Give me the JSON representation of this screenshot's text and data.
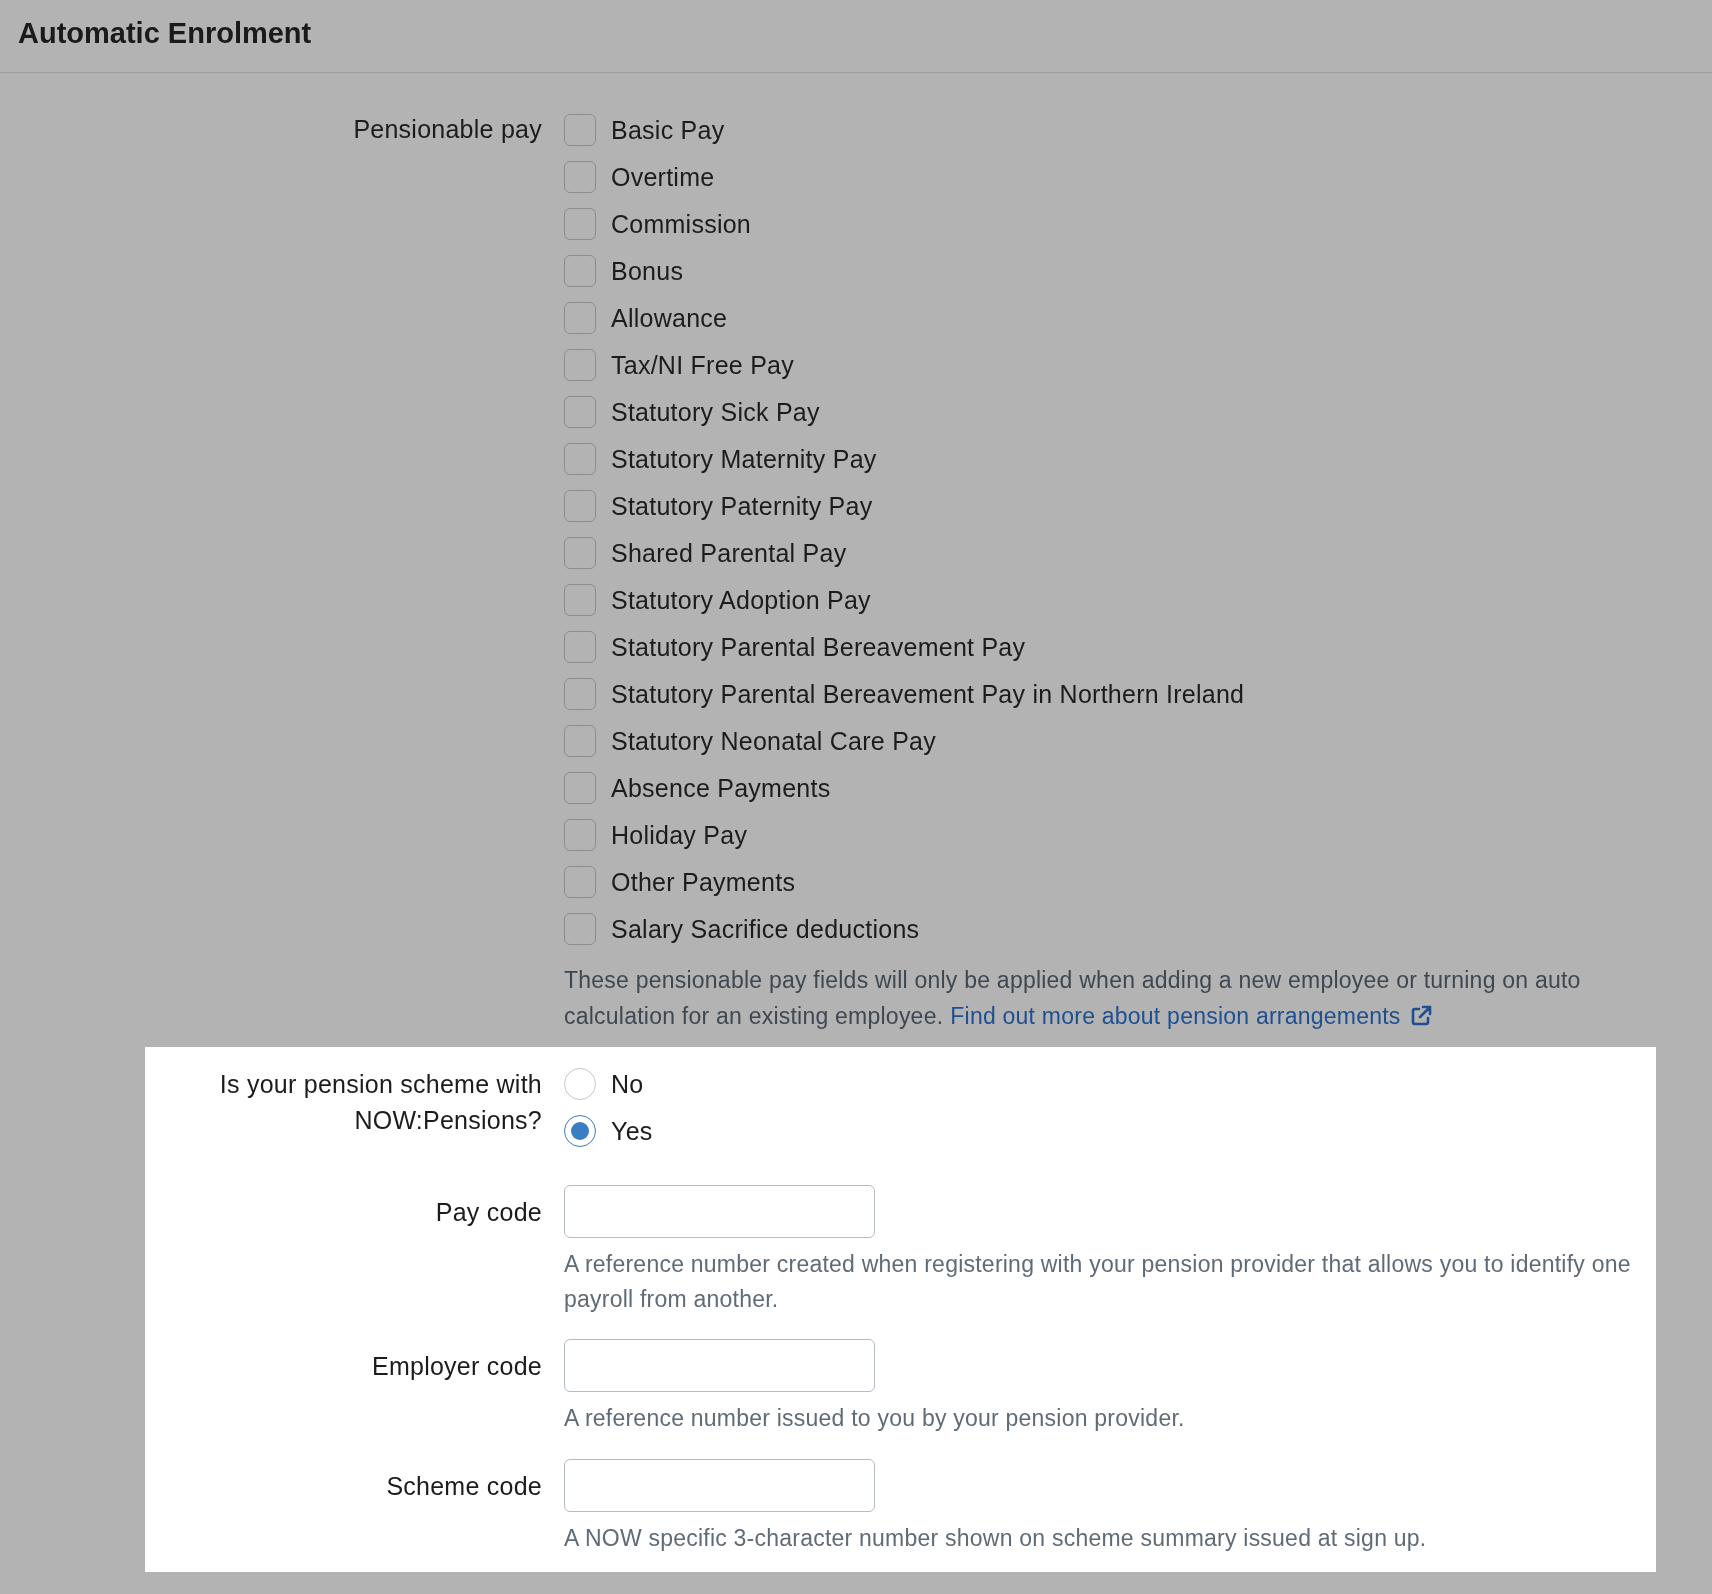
{
  "header": {
    "title": "Automatic Enrolment"
  },
  "pensionable_pay": {
    "label": "Pensionable pay",
    "options": [
      {
        "label": "Basic Pay",
        "checked": false
      },
      {
        "label": "Overtime",
        "checked": false
      },
      {
        "label": "Commission",
        "checked": false
      },
      {
        "label": "Bonus",
        "checked": false
      },
      {
        "label": "Allowance",
        "checked": false
      },
      {
        "label": "Tax/NI Free Pay",
        "checked": false
      },
      {
        "label": "Statutory Sick Pay",
        "checked": false
      },
      {
        "label": "Statutory Maternity Pay",
        "checked": false
      },
      {
        "label": "Statutory Paternity Pay",
        "checked": false
      },
      {
        "label": "Shared Parental Pay",
        "checked": false
      },
      {
        "label": "Statutory Adoption Pay",
        "checked": false
      },
      {
        "label": "Statutory Parental Bereavement Pay",
        "checked": false
      },
      {
        "label": "Statutory Parental Bereavement Pay in Northern Ireland",
        "checked": false
      },
      {
        "label": "Statutory Neonatal Care Pay",
        "checked": false
      },
      {
        "label": "Absence Payments",
        "checked": false
      },
      {
        "label": "Holiday Pay",
        "checked": false
      },
      {
        "label": "Other Payments",
        "checked": false
      },
      {
        "label": "Salary Sacrifice deductions",
        "checked": false
      }
    ],
    "help": "These pensionable pay fields will only be applied when adding a new employee or turning on auto calculation for an existing employee.",
    "link": "Find out more about pension arrangements"
  },
  "now_pensions": {
    "label": "Is your pension scheme with NOW:Pensions?",
    "options": [
      {
        "label": "No",
        "selected": false
      },
      {
        "label": "Yes",
        "selected": true
      }
    ]
  },
  "fields": [
    {
      "label": "Pay code",
      "help": "A reference number created when registering with your pension provider that allows you to identify one payroll from another."
    },
    {
      "label": "Employer code",
      "help": "A reference number issued to you by your pension provider."
    },
    {
      "label": "Scheme code",
      "help": "A NOW specific 3-character number shown on scheme summary issued at sign up."
    }
  ]
}
